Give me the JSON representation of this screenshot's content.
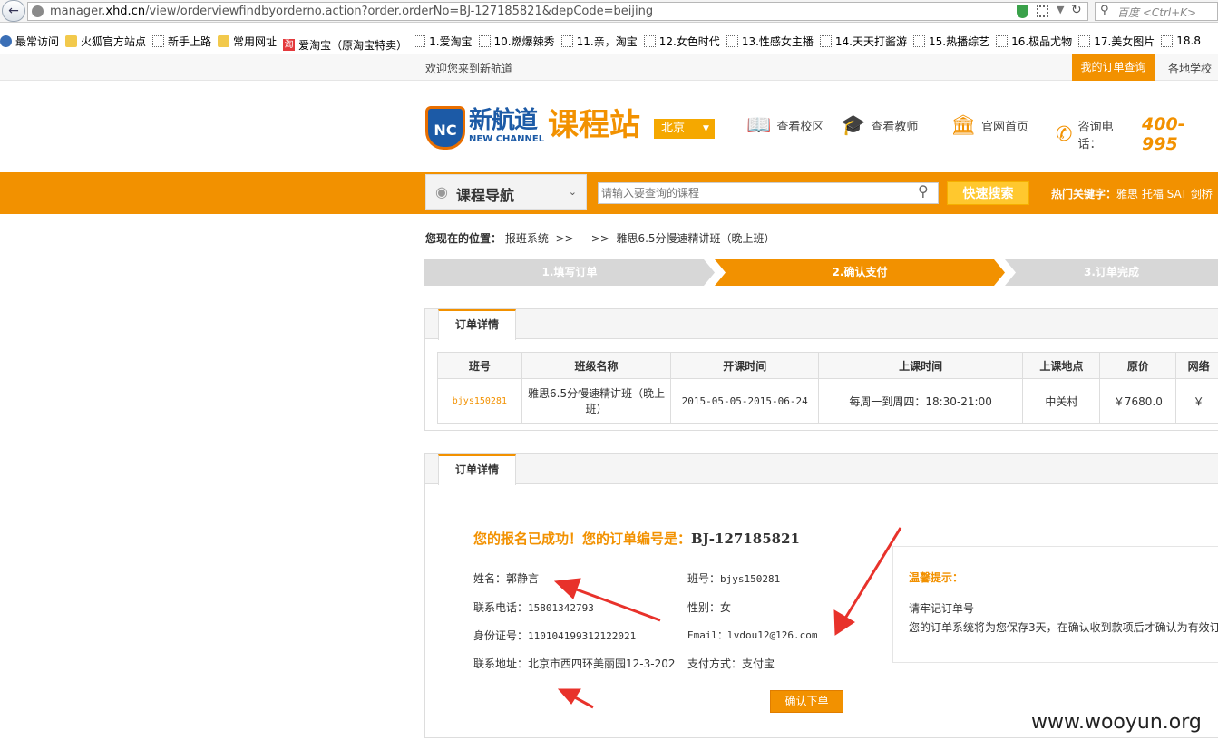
{
  "browser": {
    "url_prefix": "manager.",
    "url_domain": "xhd.cn",
    "url_path": "/view/orderviewfindbyorderno.action?order.orderNo=BJ-127185821&depCode=beijing",
    "search_placeholder": "百度 <Ctrl+K>",
    "bookmarks": [
      "最常访问",
      "火狐官方站点",
      "新手上路",
      "常用网址",
      "爱淘宝（原淘宝特卖）",
      "1.爱淘宝",
      "10.燃爆辣秀",
      "11.亲，淘宝",
      "12.女色时代",
      "13.性感女主播",
      "14.天天打酱游",
      "15.热播综艺",
      "16.极品尤物",
      "17.美女图片",
      "18.8"
    ]
  },
  "topbar": {
    "welcome": "欢迎您来到新航道",
    "my_order": "我的订单查询",
    "schools": "各地学校"
  },
  "header": {
    "logo_text": "NC",
    "brand": "新航道",
    "brand_en": "NEW CHANNEL",
    "site_title": "课程站",
    "city": "北京",
    "nav": [
      {
        "label": "查看校区",
        "icon": "book-icon"
      },
      {
        "label": "查看教师",
        "icon": "graduation-cap-icon"
      },
      {
        "label": "官网首页",
        "icon": "building-icon"
      }
    ],
    "phone_label": "咨询电话：",
    "phone_number": "400-995"
  },
  "searchbar": {
    "course_nav": "课程导航",
    "placeholder": "请输入要查询的课程",
    "button": "快速搜索",
    "hot_label": "热门关键字：",
    "hot_keywords": "雅思 托福 SAT 剑桥"
  },
  "breadcrumb": {
    "label": "您现在的位置：",
    "items": [
      "报班系统",
      ">>",
      ">>",
      "雅思6.5分慢速精讲班（晚上班）"
    ]
  },
  "steps": [
    "1.填写订单",
    "2.确认支付",
    "3.订单完成"
  ],
  "course_panel": {
    "tab": "订单详情",
    "headers": [
      "班号",
      "班级名称",
      "开课时间",
      "上课时间",
      "上课地点",
      "原价",
      "网络"
    ],
    "row": {
      "code": "bjys150281",
      "name": "雅思6.5分慢速精讲班（晚上班）",
      "dates": "2015-05-05-2015-06-24",
      "time": "每周一到周四：18:30-21:00",
      "location": "中关村",
      "price": "￥7680.0",
      "net_price": "￥"
    }
  },
  "order_panel": {
    "tab": "订单详情",
    "success_text": "您的报名已成功！您的订单编号是：",
    "order_no": "BJ-127185821",
    "fields": {
      "name_label": "姓名：",
      "name": "郭静言",
      "phone_label": "联系电话：",
      "phone": "15801342793",
      "id_label": "身份证号：",
      "id": "110104199312122021",
      "address_label": "联系地址：",
      "address": "北京市西四环美丽园12-3-202",
      "class_label": "班号：",
      "class": "bjys150281",
      "gender_label": "性别：",
      "gender": "女",
      "email_label": "Email：",
      "email": "lvdou12@126.com",
      "payment_label": "支付方式：",
      "payment": "支付宝"
    },
    "confirm": "确认下单",
    "tips": {
      "title": "温馨提示：",
      "line1": "请牢记订单号",
      "line2": "您的订单系统将为您保存3天，在确认收到款项后才确认为有效订"
    }
  },
  "watermark": "www.wooyun.org",
  "colors": {
    "accent": "#f29100",
    "brand_blue": "#1c5aa6",
    "arrow_red": "#e8322b"
  }
}
